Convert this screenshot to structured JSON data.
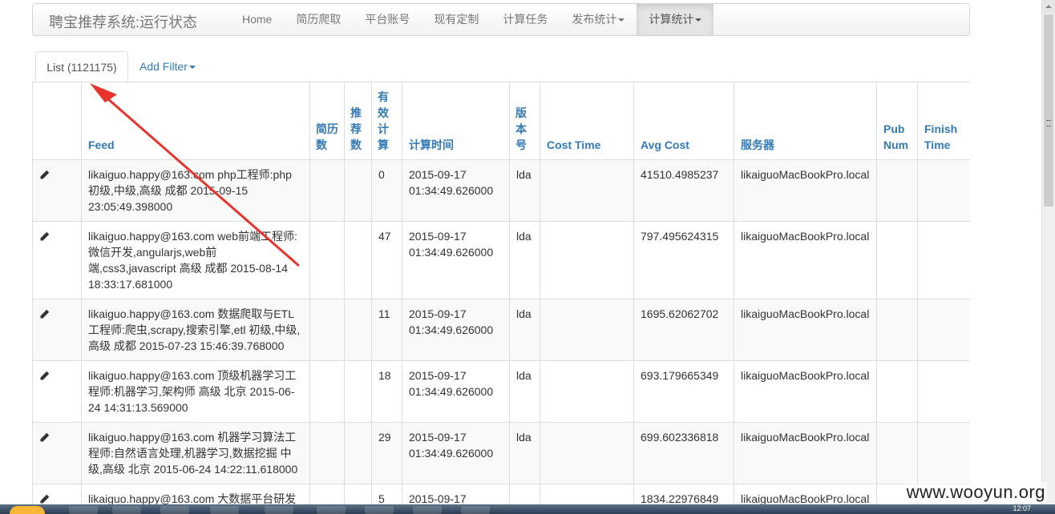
{
  "navbar": {
    "brand": "聘宝推荐系统:运行状态",
    "items": [
      {
        "label": "Home",
        "dropdown": false
      },
      {
        "label": "简历爬取",
        "dropdown": false
      },
      {
        "label": "平台账号",
        "dropdown": false
      },
      {
        "label": "现有定制",
        "dropdown": false
      },
      {
        "label": "计算任务",
        "dropdown": false
      },
      {
        "label": "发布统计",
        "dropdown": true
      },
      {
        "label": "计算统计",
        "dropdown": true
      }
    ]
  },
  "tabs": {
    "list_label": "List (1121175)",
    "add_filter_label": "Add Filter"
  },
  "table": {
    "headers": [
      "",
      "Feed",
      "简历数",
      "推荐数",
      "有效计算",
      "计算时间",
      "版本号",
      "Cost Time",
      "Avg Cost",
      "服务器",
      "Pub Num",
      "Finish Time"
    ],
    "rows": [
      {
        "feed": "likaiguo.happy@163.com php工程师:php 初级,中级,高级 成都 2015-09-15 23:05:49.398000",
        "resumes": "",
        "recommends": "",
        "valid": "0",
        "calc_time": "2015-09-17 01:34:49.626000",
        "version": "lda",
        "cost_time": "",
        "avg_cost": "41510.4985237",
        "server": "likaiguoMacBookPro.local",
        "pub_num": "",
        "finish_time": ""
      },
      {
        "feed": "likaiguo.happy@163.com web前端工程师:微信开发,angularjs,web前端,css3,javascript 高级 成都 2015-08-14 18:33:17.681000",
        "resumes": "",
        "recommends": "",
        "valid": "47",
        "calc_time": "2015-09-17 01:34:49.626000",
        "version": "lda",
        "cost_time": "",
        "avg_cost": "797.495624315",
        "server": "likaiguoMacBookPro.local",
        "pub_num": "",
        "finish_time": ""
      },
      {
        "feed": "likaiguo.happy@163.com 数据爬取与ETL工程师:爬虫,scrapy,搜索引擎,etl 初级,中级,高级 成都 2015-07-23 15:46:39.768000",
        "resumes": "",
        "recommends": "",
        "valid": "11",
        "calc_time": "2015-09-17 01:34:49.626000",
        "version": "lda",
        "cost_time": "",
        "avg_cost": "1695.62062702",
        "server": "likaiguoMacBookPro.local",
        "pub_num": "",
        "finish_time": ""
      },
      {
        "feed": "likaiguo.happy@163.com 顶级机器学习工程师:机器学习,架构师 高级 北京 2015-06-24 14:31:13.569000",
        "resumes": "",
        "recommends": "",
        "valid": "18",
        "calc_time": "2015-09-17 01:34:49.626000",
        "version": "lda",
        "cost_time": "",
        "avg_cost": "693.179665349",
        "server": "likaiguoMacBookPro.local",
        "pub_num": "",
        "finish_time": ""
      },
      {
        "feed": "likaiguo.happy@163.com 机器学习算法工程师:自然语言处理,机器学习,数据挖掘 中级,高级 北京 2015-06-24 14:22:11.618000",
        "resumes": "",
        "recommends": "",
        "valid": "29",
        "calc_time": "2015-09-17 01:34:49.626000",
        "version": "lda",
        "cost_time": "",
        "avg_cost": "699.602336818",
        "server": "likaiguoMacBookPro.local",
        "pub_num": "",
        "finish_time": ""
      },
      {
        "feed": "likaiguo.happy@163.com 大数据平台研发",
        "resumes": "",
        "recommends": "",
        "valid": "5",
        "calc_time": "2015-09-17",
        "version": "",
        "cost_time": "",
        "avg_cost": "1834.22976849",
        "server": "likaiguoMacBookPro.local",
        "pub_num": "",
        "finish_time": ""
      }
    ]
  },
  "watermark": "www.wooyun.org",
  "taskbar": {
    "clock": "12:07"
  },
  "colors": {
    "link": "#337ab7",
    "arrow": "#e8332c",
    "navbar_bg": "#f8f8f8"
  }
}
